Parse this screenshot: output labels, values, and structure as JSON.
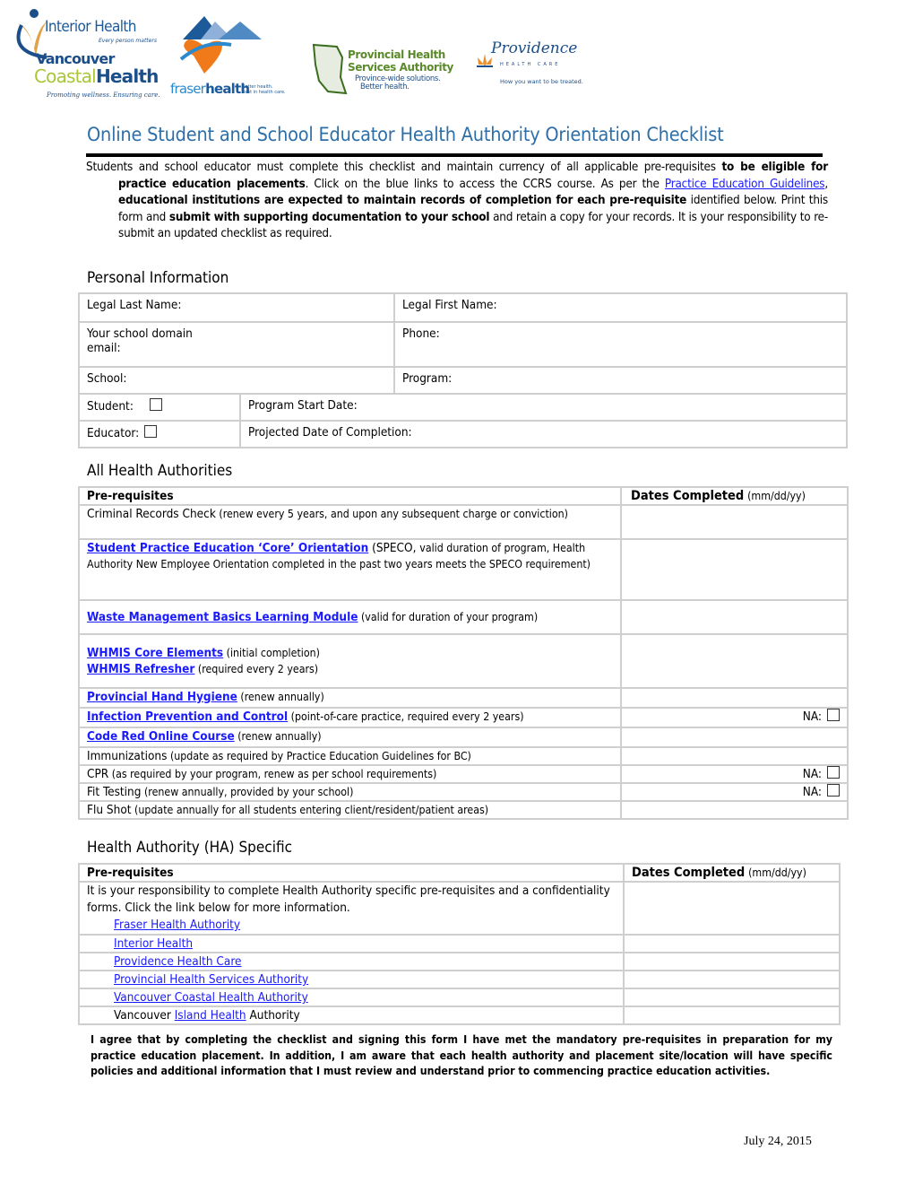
{
  "logos": {
    "interior_health": {
      "name": "Interior Health",
      "tagline": "Every person matters"
    },
    "vancouver_coastal": {
      "line1": "Vancouver",
      "line2a": "Coastal",
      "line2b": "Health",
      "tagline": "Promoting wellness. Ensuring care."
    },
    "fraser_health": {
      "name_a": "fraser",
      "name_b": "health",
      "tagline1": "Better health.",
      "tagline2": "Best in health care."
    },
    "phsa": {
      "line1": "Provincial Health",
      "line2": "Services Authority",
      "tag1": "Province-wide solutions.",
      "tag2": "Better health."
    },
    "providence": {
      "name": "Providence",
      "sub": "HEALTH CARE",
      "tagline": "How you want to be treated."
    }
  },
  "title": "Online Student and School Educator Health Authority Orientation Checklist",
  "intro": {
    "p1": "Students and school educator must complete this checklist and maintain currency of all applicable pre-requisites ",
    "p1_bold": "to be eligible for practice education placements",
    "p2": ". Click on the blue links to access the CCRS course. As per the ",
    "link": "Practice Education Guidelines",
    "p3": ", ",
    "p3_bold": "educational institutions are expected to maintain records of completion for each pre-requisite",
    "p4": " identified below. Print this form and ",
    "p4_bold": "submit with supporting documentation to your school",
    "p5": " and retain a copy for your records. It is your responsibility to re-submit an updated checklist as required."
  },
  "personal": {
    "heading": "Personal Information",
    "legal_last": "Legal Last Name:",
    "legal_first": "Legal First Name:",
    "email_1": "Your school domain",
    "email_2": "email:",
    "phone": "Phone:",
    "school": "School:",
    "program": "Program:",
    "student": "Student:",
    "program_start": "Program Start Date:",
    "educator": "Educator:",
    "projected": "Projected Date of Completion:"
  },
  "all_ha": {
    "heading": "All Health Authorities",
    "col1": "Pre-requisites",
    "col2": "Dates Completed",
    "col2_fmt": "(mm/dd/yy)",
    "na_label": "NA:",
    "rows": [
      {
        "name": "Criminal Records Check",
        "note": " (renew every 5 years, and upon any subsequent charge or conviction)"
      },
      {
        "link": "Student Practice Education ‘Core’ Orientation",
        "note_a": " (SPECO, ",
        "note": "valid duration of program, Health Authority New Employee Orientation completed in the past two years meets the SPECO requirement)"
      },
      {
        "link": "Waste Management Basics Learning Module",
        "note": " (valid for duration of your program)"
      },
      {
        "link": "WHMIS Core Elements",
        "note": " (initial completion)",
        "link2": "WHMIS Refresher",
        "note2": " (required every 2 years)"
      },
      {
        "link": "Provincial Hand Hygiene",
        "note": " (renew annually)"
      },
      {
        "link": "Infection Prevention and Control",
        "note": " (point-of-care practice, required every 2 years)"
      },
      {
        "link": "Code Red Online Course",
        "note": " (renew annually)"
      },
      {
        "name": "Immunizations",
        "note": " (update as required by Practice Education Guidelines for BC)"
      },
      {
        "name": "CPR",
        "note": " (as required by your program, renew as per school requirements)"
      },
      {
        "name": "Fit Testing",
        "note": " (renew annually, provided by your school)"
      },
      {
        "name": "Flu Shot",
        "note": " (update annually for all students entering client/resident/patient areas)"
      }
    ]
  },
  "ha_specific": {
    "heading": "Health Authority (HA) Specific",
    "col1": "Pre-requisites",
    "col2": "Dates Completed",
    "col2_fmt": "(mm/dd/yy)",
    "intro": "It is your responsibility to complete Health Authority specific pre-requisites and a confidentiality forms. Click the link below for more information.",
    "links": [
      "Fraser Health Authority ",
      "Interior Health",
      "Providence Health Care ",
      "Provincial Health Services Authority ",
      "Vancouver Coastal Health Authority "
    ],
    "last_pre": "Vancouver ",
    "last_link": "Island Health",
    "last_post": " Authority"
  },
  "agreement": "I agree that by completing the checklist and signing this form I have met the mandatory pre-requisites in preparation for my practice education placement. In addition, I am aware that each health authority and placement site/location will have specific policies and additional information that I must review and understand prior to commencing practice education activities.",
  "footer_date": "July 24,  2015"
}
